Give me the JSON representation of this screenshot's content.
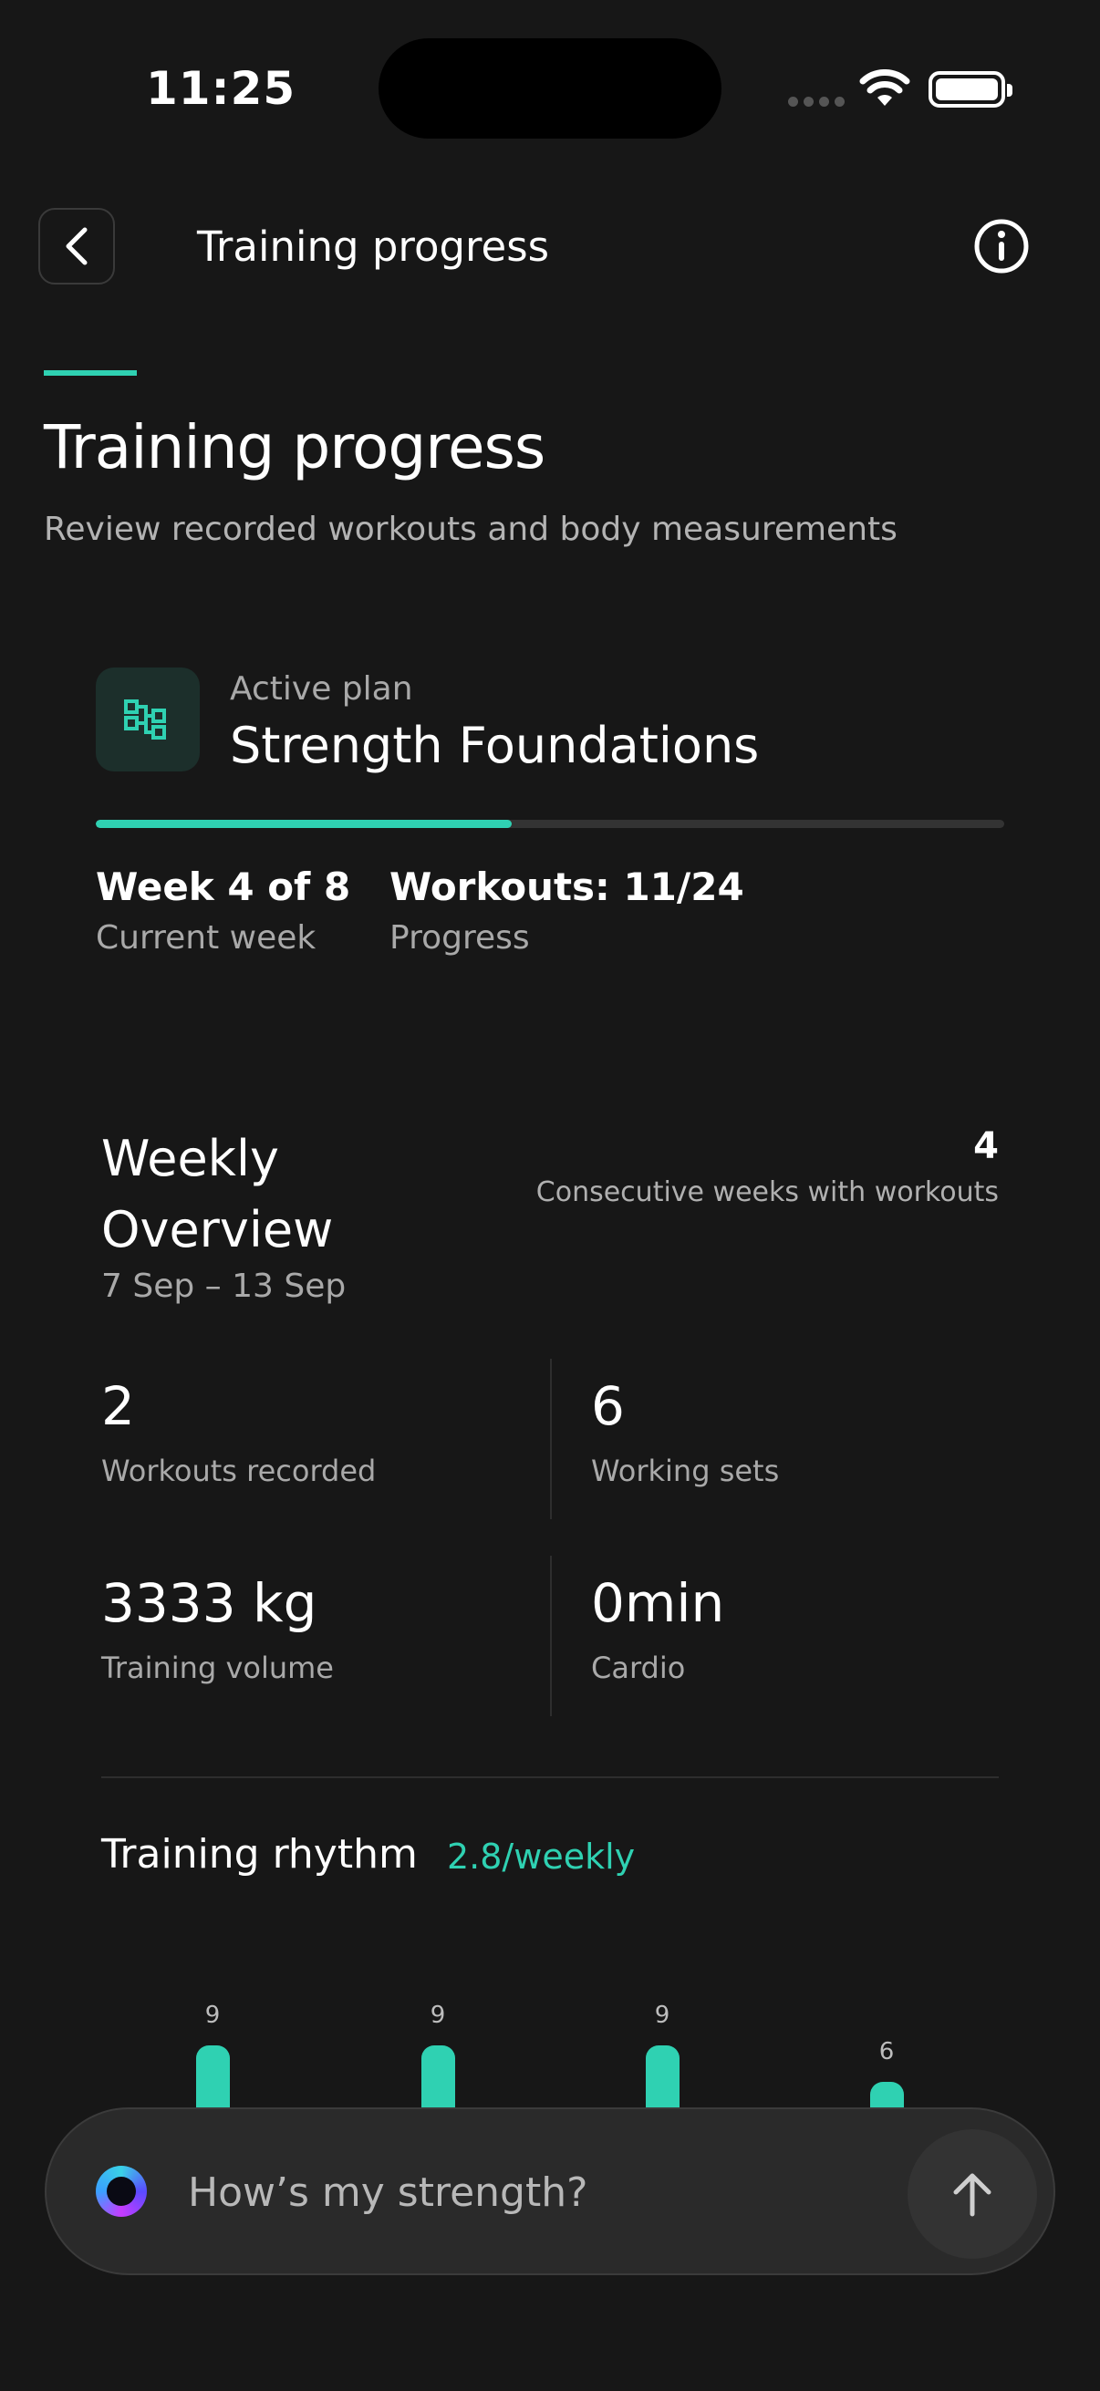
{
  "status_bar": {
    "time": "11:25"
  },
  "nav": {
    "title": "Training progress"
  },
  "header": {
    "title": "Training progress",
    "subtitle": "Review recorded workouts and body measurements"
  },
  "plan": {
    "label": "Active plan",
    "name": "Strength Foundations",
    "progress_fraction": 0.458,
    "week_value": "Week 4 of 8",
    "week_label": "Current week",
    "workouts_value": "Workouts: 11/24",
    "workouts_label": "Progress"
  },
  "weekly_overview": {
    "title": "Weekly Overview",
    "date_range": "7 Sep – 13 Sep",
    "streak_value": "4",
    "streak_label": "Consecutive weeks with workouts",
    "stats": [
      {
        "value": "2",
        "label": "Workouts recorded"
      },
      {
        "value": "6",
        "label": "Working sets"
      },
      {
        "value": "3333 kg",
        "label": "Training volume"
      },
      {
        "value": "0min",
        "label": "Cardio"
      }
    ]
  },
  "rhythm": {
    "title": "Training rhythm",
    "rate": "2.8/weekly"
  },
  "chart_data": {
    "type": "bar",
    "values": [
      9,
      9,
      9,
      6
    ],
    "data_labels": [
      "9",
      "9",
      "9",
      "6"
    ]
  },
  "chat": {
    "placeholder": "How’s my strength?"
  },
  "colors": {
    "accent": "#2fd1b2",
    "background": "#171717"
  }
}
